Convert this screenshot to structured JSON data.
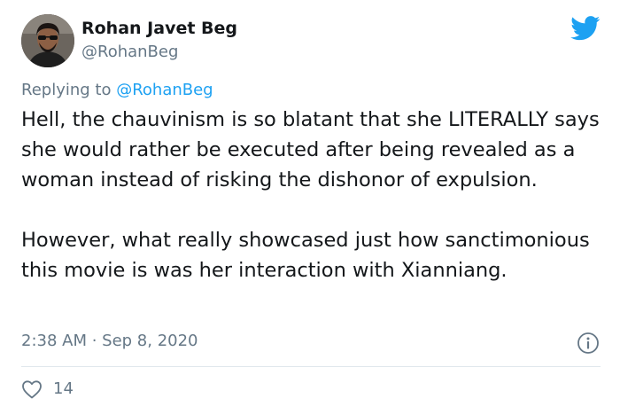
{
  "author": {
    "name": "Rohan Javet Beg",
    "handle": "@RohanBeg"
  },
  "reply": {
    "prefix": "Replying to ",
    "mention": "@RohanBeg"
  },
  "tweet": {
    "paragraphs": [
      "Hell, the chauvinism is so blatant that she LITERALLY says she would rather be executed after being revealed as a woman instead of risking the dishonor of expulsion.",
      "However, what really showcased just how sanctimonious this movie is was her interaction with Xianniang."
    ],
    "timestamp": "2:38 AM · Sep 8, 2020"
  },
  "stats": {
    "likes": "14"
  },
  "colors": {
    "brand": "#1da1f2",
    "text": "#14171a",
    "muted": "#657786",
    "divider": "#e1e8ed"
  },
  "icons": [
    "twitter-bird-icon",
    "info-icon",
    "heart-icon"
  ]
}
